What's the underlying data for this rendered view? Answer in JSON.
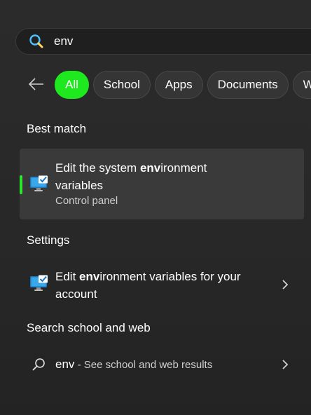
{
  "search": {
    "value": "env",
    "icon": "search-icon",
    "accent_color": "#4cc2ff"
  },
  "filters": {
    "back_icon": "arrow-left-icon",
    "chips": [
      {
        "label": "All",
        "active": true
      },
      {
        "label": "School",
        "active": false
      },
      {
        "label": "Apps",
        "active": false
      },
      {
        "label": "Documents",
        "active": false
      },
      {
        "label": "W",
        "active": false
      }
    ],
    "active_color": "#1ee81e"
  },
  "best_match": {
    "heading": "Best match",
    "title_prefix": "Edit the system ",
    "title_highlight": "env",
    "title_suffix": "ironment variables",
    "subtitle": "Control panel",
    "icon": "control-panel-icon"
  },
  "settings": {
    "heading": "Settings",
    "item": {
      "text_prefix": "Edit ",
      "text_highlight": "env",
      "text_suffix": "ironment variables for your account",
      "icon": "control-panel-icon",
      "chevron": "chevron-right-icon"
    }
  },
  "web": {
    "heading": "Search school and web",
    "item": {
      "query": "env",
      "suffix": " - See school and web results",
      "icon": "search-icon",
      "chevron": "chevron-right-icon"
    }
  }
}
